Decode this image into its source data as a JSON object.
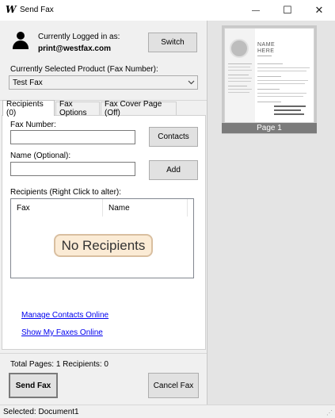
{
  "window": {
    "logo": "W",
    "title": "Send Fax",
    "minimize_glyph": "—",
    "maximize_glyph": "☐",
    "close_glyph": "✕"
  },
  "account": {
    "logged_in_label": "Currently Logged in as:",
    "email": "print@westfax.com",
    "switch_label": "Switch"
  },
  "product": {
    "label": "Currently Selected Product (Fax Number):",
    "selected": "Test Fax"
  },
  "tabs": [
    {
      "label": "Recipients (0)",
      "active": true
    },
    {
      "label": "Fax Options",
      "active": false
    },
    {
      "label": "Fax Cover Page (Off)",
      "active": false
    }
  ],
  "recipients_tab": {
    "fax_number_label": "Fax Number:",
    "fax_number_value": "",
    "contacts_label": "Contacts",
    "name_label": "Name (Optional):",
    "name_value": "",
    "add_label": "Add",
    "list_label": "Recipients (Right Click to alter):",
    "columns": [
      "Fax",
      "Name"
    ],
    "empty_text": "No Recipients"
  },
  "links": {
    "manage_contacts": "Manage Contacts Online",
    "show_faxes": "Show My Faxes Online"
  },
  "summary": {
    "text": "Total Pages: 1  Recipients: 0"
  },
  "actions": {
    "send_label": "Send Fax",
    "cancel_label": "Cancel Fax"
  },
  "preview": {
    "page_caption": "Page 1",
    "thumb_name_line1": "NAME",
    "thumb_name_line2": "HERE"
  },
  "status": {
    "text": "Selected: Document1",
    "grip": "⋰"
  }
}
